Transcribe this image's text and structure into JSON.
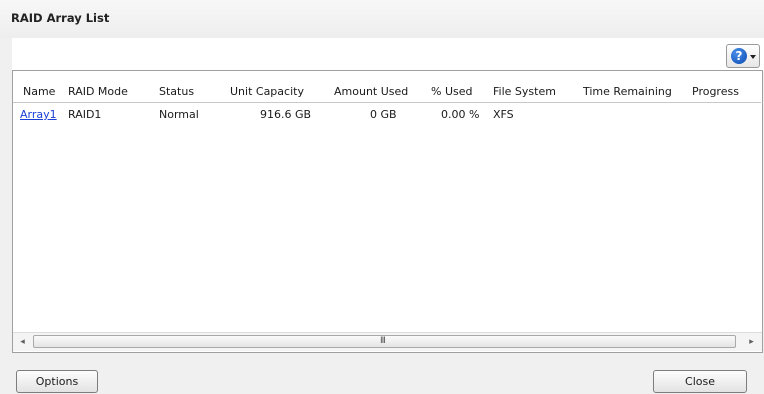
{
  "window": {
    "title": "RAID Array List"
  },
  "toolbar": {
    "help_icon_glyph": "?",
    "help_icon": "question-circle-icon"
  },
  "table": {
    "columns": [
      "Name",
      "RAID Mode",
      "Status",
      "Unit Capacity",
      "Amount Used",
      "% Used",
      "File System",
      "Time Remaining",
      "Progress"
    ],
    "rows": [
      {
        "name": "Array1",
        "raid_mode": "RAID1",
        "status": "Normal",
        "unit_capacity": "916.6 GB",
        "amount_used": "0 GB",
        "percent_used": "0.00 %",
        "file_system": "XFS",
        "time_remaining": "",
        "progress": ""
      }
    ]
  },
  "scrollbar": {
    "left_arrow": "◂",
    "right_arrow": "▸",
    "grip": "III"
  },
  "buttons": {
    "options": "Options",
    "close": "Close"
  },
  "colors": {
    "link": "#1a3fd6",
    "help_icon": "#0b4cb4"
  }
}
